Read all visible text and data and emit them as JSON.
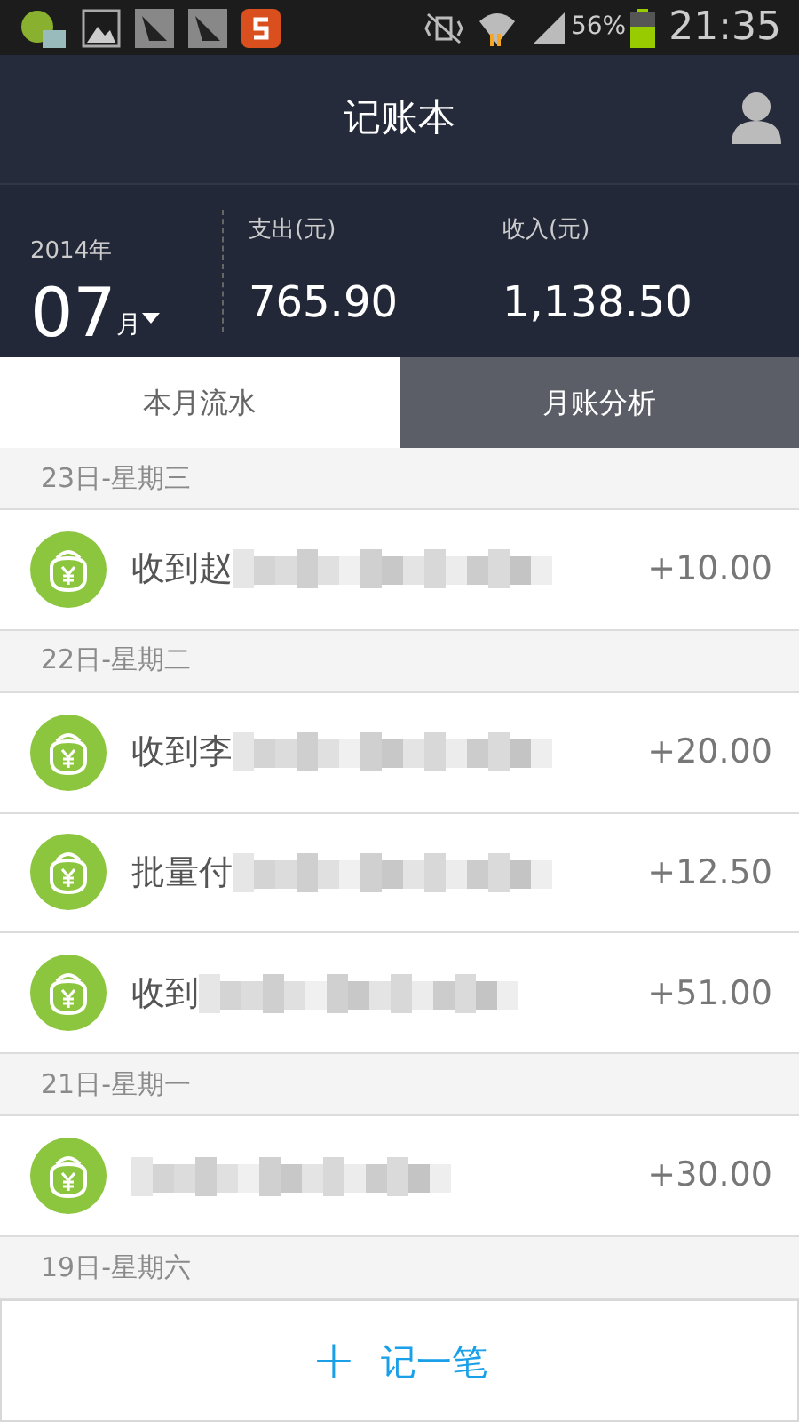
{
  "status_bar": {
    "battery": "56%",
    "time": "21:35"
  },
  "header": {
    "title": "记账本"
  },
  "summary": {
    "year": "2014年",
    "month": "07",
    "month_unit": "月",
    "expense_label": "支出(元)",
    "expense": "765.90",
    "income_label": "收入(元)",
    "income": "1,138.50"
  },
  "tabs": [
    {
      "label": "本月流水",
      "selected": true
    },
    {
      "label": "月账分析",
      "selected": false
    }
  ],
  "entries": [
    {
      "kind": "date",
      "label": "23日-星期三"
    },
    {
      "kind": "record",
      "text": "收到赵",
      "amount": "+10.00"
    },
    {
      "kind": "date",
      "label": "22日-星期二"
    },
    {
      "kind": "record",
      "text": "收到李",
      "amount": "+20.00"
    },
    {
      "kind": "record",
      "text": "批量付",
      "amount": "+12.50"
    },
    {
      "kind": "record",
      "text": "收到",
      "amount": "+51.00"
    },
    {
      "kind": "date",
      "label": "21日-星期一"
    },
    {
      "kind": "record",
      "amount": "+30.00"
    },
    {
      "kind": "date",
      "label": "19日-星期六"
    }
  ],
  "add_button": {
    "icon": "+",
    "label": "记一笔"
  }
}
